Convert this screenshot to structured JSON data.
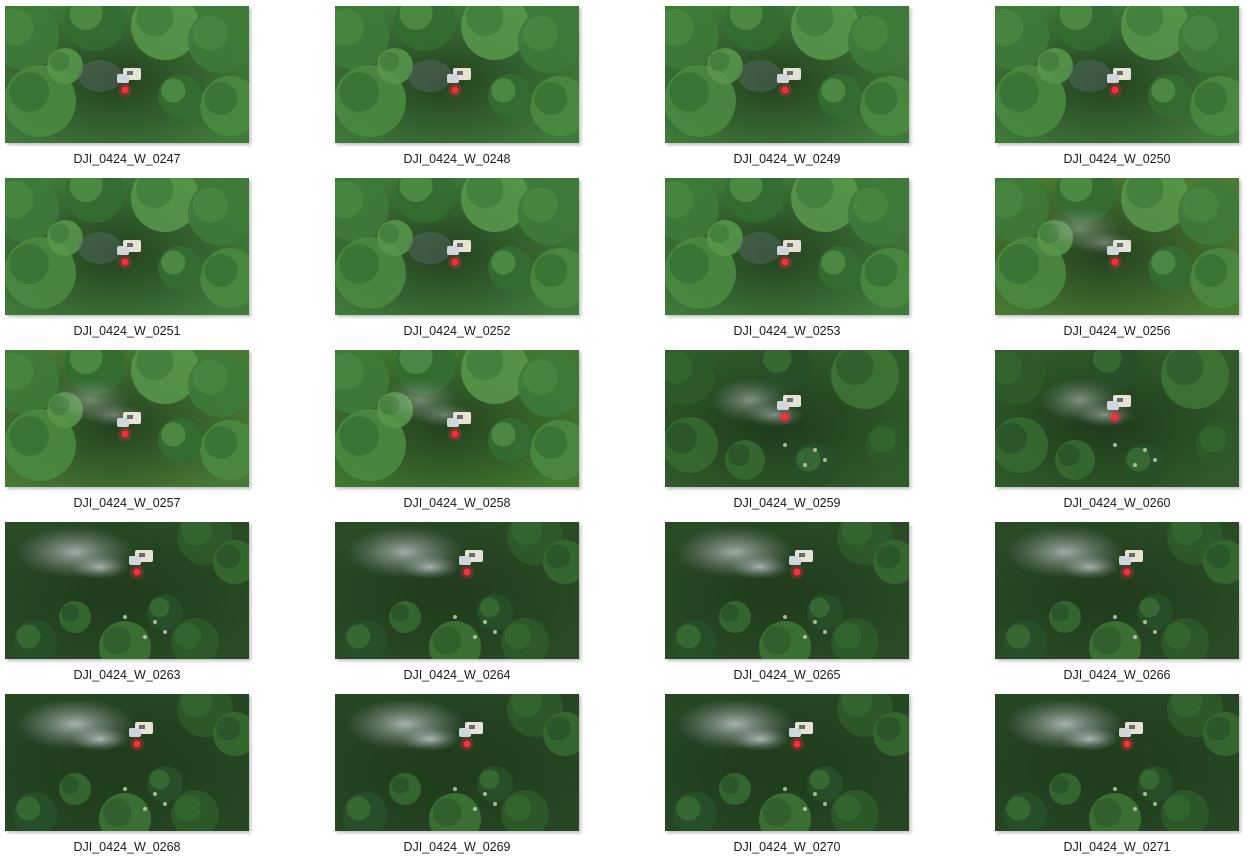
{
  "gallery": {
    "items": [
      {
        "name": "DJI_0424_W_0247",
        "stage": 0,
        "tint": "#3f7a3a"
      },
      {
        "name": "DJI_0424_W_0248",
        "stage": 0,
        "tint": "#3f7a3a"
      },
      {
        "name": "DJI_0424_W_0249",
        "stage": 0,
        "tint": "#3f7a3a"
      },
      {
        "name": "DJI_0424_W_0250",
        "stage": 0,
        "tint": "#3f7a3a"
      },
      {
        "name": "DJI_0424_W_0251",
        "stage": 0,
        "tint": "#3f7a3a"
      },
      {
        "name": "DJI_0424_W_0252",
        "stage": 0,
        "tint": "#3f7a3a"
      },
      {
        "name": "DJI_0424_W_0253",
        "stage": 0,
        "tint": "#3f7a3a"
      },
      {
        "name": "DJI_0424_W_0256",
        "stage": 1,
        "tint": "#4a7a32"
      },
      {
        "name": "DJI_0424_W_0257",
        "stage": 1,
        "tint": "#477a34"
      },
      {
        "name": "DJI_0424_W_0258",
        "stage": 1,
        "tint": "#40782f"
      },
      {
        "name": "DJI_0424_W_0259",
        "stage": 2,
        "tint": "#2f5a29"
      },
      {
        "name": "DJI_0424_W_0260",
        "stage": 2,
        "tint": "#2f5a29"
      },
      {
        "name": "DJI_0424_W_0263",
        "stage": 3,
        "tint": "#2a4a26"
      },
      {
        "name": "DJI_0424_W_0264",
        "stage": 3,
        "tint": "#2a4a26"
      },
      {
        "name": "DJI_0424_W_0265",
        "stage": 3,
        "tint": "#2a4a26"
      },
      {
        "name": "DJI_0424_W_0266",
        "stage": 3,
        "tint": "#2a4a26"
      },
      {
        "name": "DJI_0424_W_0268",
        "stage": 4,
        "tint": "#264624"
      },
      {
        "name": "DJI_0424_W_0269",
        "stage": 4,
        "tint": "#264624"
      },
      {
        "name": "DJI_0424_W_0270",
        "stage": 4,
        "tint": "#264624"
      },
      {
        "name": "DJI_0424_W_0271",
        "stage": 4,
        "tint": "#264624"
      }
    ]
  }
}
